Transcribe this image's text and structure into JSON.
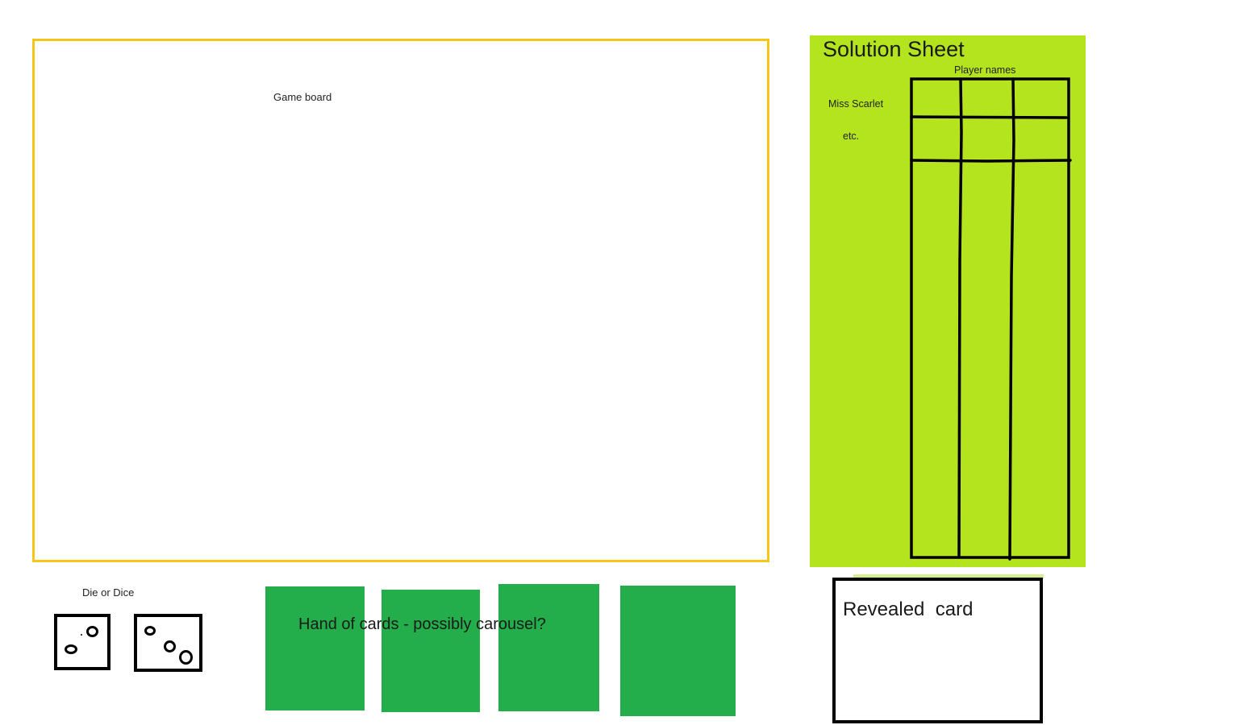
{
  "game_board": {
    "label": "Game board",
    "border_color": "#f5c518"
  },
  "solution_sheet": {
    "title": "Solution Sheet",
    "column_header": "Player names",
    "rows": [
      {
        "label": "Miss Scarlet"
      },
      {
        "label": "etc."
      }
    ],
    "background_color": "#b4e41e"
  },
  "dice": {
    "label": "Die or Dice",
    "dice": [
      {
        "name": "die-1",
        "value": 3
      },
      {
        "name": "die-2",
        "value": 3
      }
    ]
  },
  "hand": {
    "label": "Hand of cards - possibly carousel?",
    "card_color": "#24ae4b",
    "card_count": 4
  },
  "revealed": {
    "label": "Revealed  card"
  }
}
